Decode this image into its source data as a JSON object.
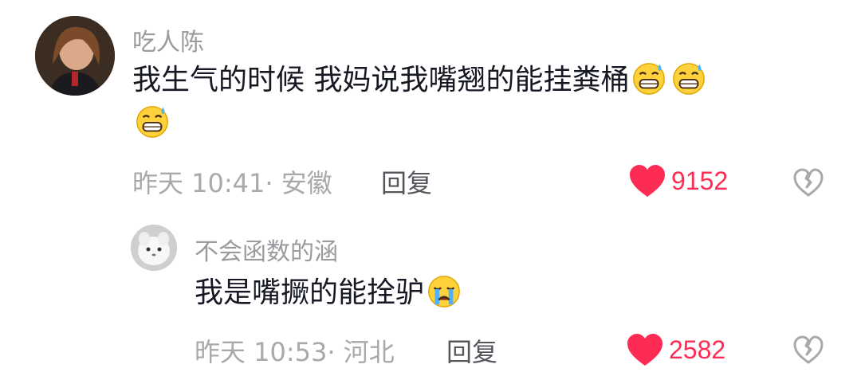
{
  "comment": {
    "author": "吃人陈",
    "text": "我生气的时候 我妈说我嘴翘的能挂粪桶",
    "emoji": [
      "grin-sweat-icon",
      "grin-sweat-icon",
      "grin-sweat-icon"
    ],
    "time_location": "昨天 10:41· 安徽",
    "reply_label": "回复",
    "likes": "9152"
  },
  "reply": {
    "author": "不会函数的涵",
    "text": "我是嘴撅的能拴驴",
    "emoji": [
      "crying-face-icon"
    ],
    "time_location": "昨天 10:53· 河北",
    "reply_label": "回复",
    "likes": "2582"
  },
  "colors": {
    "like_red": "#fe2c55",
    "meta_gray": "#a8a8ad",
    "text_dark": "#161823"
  }
}
